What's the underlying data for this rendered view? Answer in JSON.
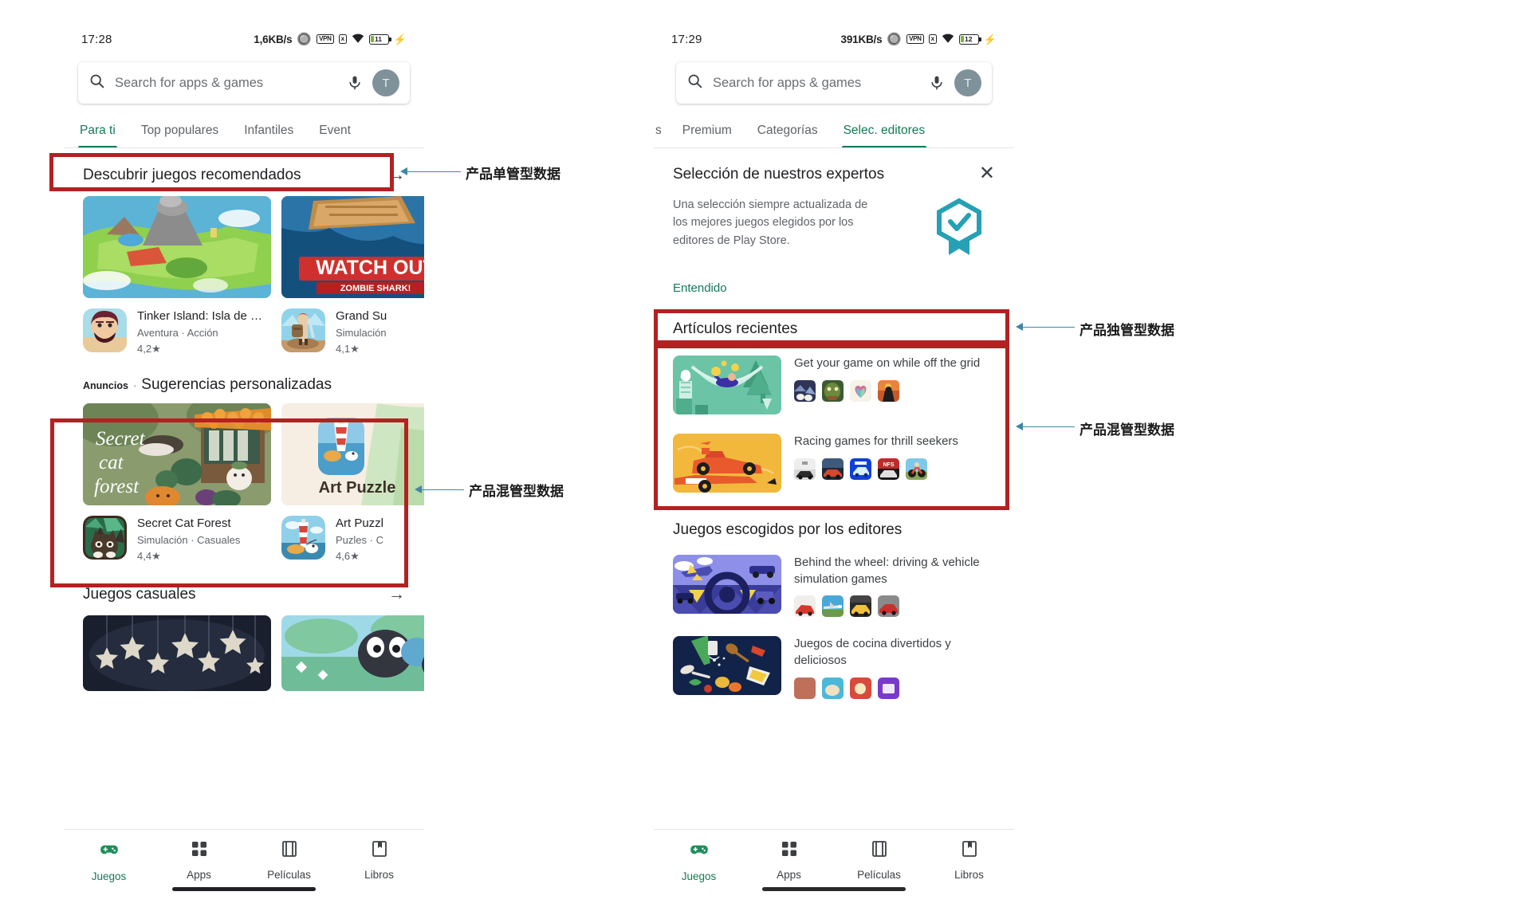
{
  "left_phone": {
    "status": {
      "time": "17:28",
      "net_speed": "1,6KB/s",
      "bluetooth_icon": "bluetooth-icon",
      "vpn_label": "VPN",
      "mute_label": "x",
      "wifi_icon": "wifi-icon",
      "battery_level": "11",
      "charging_icon": "bolt-icon"
    },
    "search": {
      "placeholder": "Search for apps & games",
      "search_icon": "search-icon",
      "mic_icon": "microphone-icon",
      "avatar_initial": "T"
    },
    "tabs": [
      {
        "label": "Para ti",
        "active": true
      },
      {
        "label": "Top populares",
        "active": false
      },
      {
        "label": "Infantiles",
        "active": false
      },
      {
        "label": "Event",
        "active": false
      }
    ],
    "section_discover": {
      "title": "Descubrir juegos recomendados",
      "arrow_icon": "arrow-right-icon",
      "apps": [
        {
          "name": "Tinker Island: Isla de …",
          "category": "Aventura  ·  Acción",
          "rating": "4,2★"
        },
        {
          "name": "Grand Su",
          "category": "Simulación",
          "rating": "4,1★"
        }
      ]
    },
    "section_ads": {
      "ads_badge": "Anuncios",
      "separator": "·",
      "title": "Sugerencias personalizadas",
      "apps": [
        {
          "name": "Secret Cat Forest",
          "category": "Simulación  ·  Casuales",
          "rating": "4,4★",
          "banner_text": "Secret cat forest"
        },
        {
          "name": "Art Puzzl",
          "category": "Puzles  ·  C",
          "rating": "4,6★",
          "banner_text": "Art Puzzle"
        }
      ]
    },
    "section_casual": {
      "title": "Juegos casuales",
      "arrow_icon": "arrow-right-icon"
    },
    "bottom_nav": [
      {
        "label": "Juegos",
        "icon": "gamepad-icon",
        "active": true
      },
      {
        "label": "Apps",
        "icon": "apps-grid-icon",
        "active": false
      },
      {
        "label": "Películas",
        "icon": "film-icon",
        "active": false
      },
      {
        "label": "Libros",
        "icon": "book-icon",
        "active": false
      }
    ]
  },
  "right_phone": {
    "status": {
      "time": "17:29",
      "net_speed": "391KB/s",
      "bluetooth_icon": "bluetooth-icon",
      "vpn_label": "VPN",
      "mute_label": "x",
      "wifi_icon": "wifi-icon",
      "battery_level": "12",
      "charging_icon": "bolt-icon"
    },
    "search": {
      "placeholder": "Search for apps & games",
      "search_icon": "search-icon",
      "mic_icon": "microphone-icon",
      "avatar_initial": "T"
    },
    "tabs": [
      {
        "label": "s",
        "active": false
      },
      {
        "label": "Premium",
        "active": false
      },
      {
        "label": "Categorías",
        "active": false
      },
      {
        "label": "Selec. editores",
        "active": true
      }
    ],
    "expert_card": {
      "title": "Selección de nuestros expertos",
      "close_icon": "close-icon",
      "body": "Una selección siempre actualizada de los mejores juegos elegidos por los editores de Play Store.",
      "badge_icon": "verified-badge-icon",
      "cta": "Entendido"
    },
    "section_recent": {
      "title": "Artículos recientes",
      "articles": [
        {
          "title": "Get your game on while off the grid",
          "icon_count": 4
        },
        {
          "title": "Racing games for thrill seekers",
          "icon_count": 5
        }
      ]
    },
    "section_editors": {
      "title": "Juegos escogidos por los editores",
      "articles": [
        {
          "title": "Behind the wheel: driving & vehicle simulation games",
          "icon_count": 4
        },
        {
          "title": "Juegos de cocina divertidos y deliciosos",
          "icon_count": 4
        }
      ]
    },
    "bottom_nav": [
      {
        "label": "Juegos",
        "icon": "gamepad-icon",
        "active": true
      },
      {
        "label": "Apps",
        "icon": "apps-grid-icon",
        "active": false
      },
      {
        "label": "Películas",
        "icon": "film-icon",
        "active": false
      },
      {
        "label": "Libros",
        "icon": "book-icon",
        "active": false
      }
    ]
  },
  "annotations": [
    {
      "id": "a1",
      "text": "产品单管型数据"
    },
    {
      "id": "a2",
      "text": "产品混管型数据"
    },
    {
      "id": "a3",
      "text": "产品独管型数据"
    },
    {
      "id": "a4",
      "text": "产品混管型数据"
    }
  ],
  "colors": {
    "accent_green": "#137a54",
    "annotation_red": "#b32121",
    "annotation_line": "#3f87a6"
  }
}
